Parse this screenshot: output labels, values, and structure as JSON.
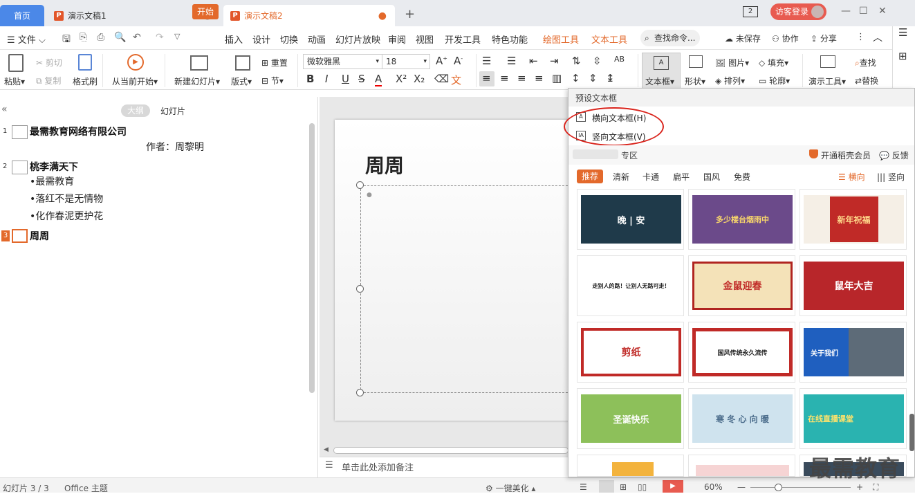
{
  "titlebar": {
    "tabs": [
      {
        "label": "首页"
      },
      {
        "label": "演示文稿1",
        "close": "●"
      },
      {
        "label": "演示文稿2",
        "close": "●"
      }
    ],
    "add_tab": "+",
    "window_count": "2",
    "guest_login": "访客登录",
    "minimize": "—",
    "maximize": "☐",
    "close": "✕"
  },
  "menubar": {
    "file": "文件",
    "items": [
      "开始",
      "插入",
      "设计",
      "切换",
      "动画",
      "幻灯片放映",
      "审阅",
      "视图",
      "开发工具",
      "特色功能",
      "绘图工具",
      "文本工具"
    ],
    "search_placeholder": "查找命令...",
    "unsaved": "未保存",
    "collaborate": "协作",
    "share": "分享"
  },
  "ribbon": {
    "paste": "粘贴",
    "cut": "剪切",
    "copy": "复制",
    "format_painter": "格式刷",
    "from_current": "从当前开始",
    "new_slide": "新建幻灯片",
    "layout": "版式",
    "reset": "重置",
    "section": "节",
    "font_name": "微软雅黑",
    "font_size": "18",
    "textbox": "文本框",
    "shape": "形状",
    "picture": "图片",
    "fill": "填充",
    "arrange": "排列",
    "outline": "轮廓",
    "present_tools": "演示工具",
    "find": "查找",
    "replace": "替换"
  },
  "leftpanel": {
    "tab_outline": "大纲",
    "tab_slides": "幻灯片",
    "slides": [
      {
        "num": "1",
        "title": "最需教育网络有限公司",
        "lines": [
          "作者：周黎明"
        ]
      },
      {
        "num": "2",
        "title": "桃李满天下",
        "lines": [
          "•最需教育",
          "•落红不是无情物",
          "•化作春泥更护花"
        ]
      },
      {
        "num": "3",
        "title": "周周",
        "lines": []
      }
    ]
  },
  "slide": {
    "title": "周周",
    "notes": "单击此处添加备注"
  },
  "statusbar": {
    "slide_count": "幻灯片 3 / 3",
    "theme": "Office 主题",
    "beautify": "一键美化",
    "zoom": "60%"
  },
  "dropdown": {
    "header": "预设文本框",
    "horizontal": "横向文本框(H)",
    "vertical": "竖向文本框(V)",
    "zone": "专区",
    "vip": "开通稻壳会员",
    "feedback": "反馈",
    "categories": [
      "推荐",
      "清新",
      "卡通",
      "扁平",
      "国风",
      "免费"
    ],
    "orient_h": "横向",
    "orient_v": "竖向",
    "cards": [
      {
        "text": "晚 | 安"
      },
      {
        "text": "多少楼台烟雨中"
      },
      {
        "text": "新年祝福"
      },
      {
        "text": "走别人的路！让别人无路可走！"
      },
      {
        "text": "金鼠迎春"
      },
      {
        "text": "鼠年大吉"
      },
      {
        "text": "剪纸"
      },
      {
        "text": "国风传统永久流传"
      },
      {
        "text": "关于我们"
      },
      {
        "text": "圣诞快乐"
      },
      {
        "text": "寒 冬 心 向 暖"
      },
      {
        "text": "在线直播课堂"
      }
    ],
    "watermark": "最需教育"
  }
}
